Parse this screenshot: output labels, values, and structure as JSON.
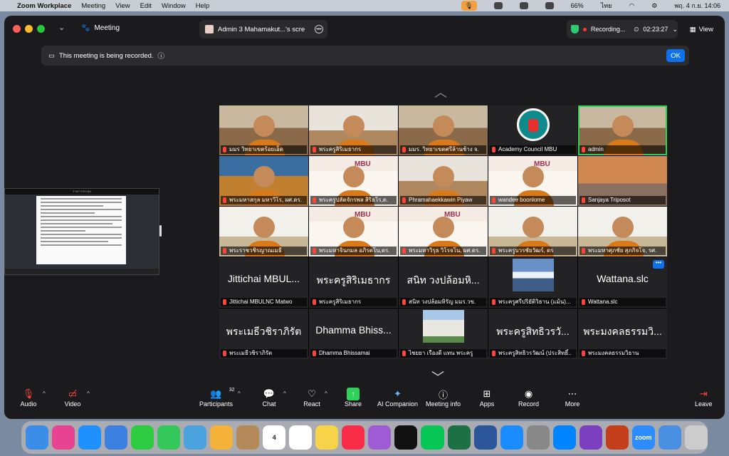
{
  "menubar": {
    "app": "Zoom Workplace",
    "items": [
      "Meeting",
      "View",
      "Edit",
      "Window",
      "Help"
    ],
    "battery": "66%",
    "lang": "ไทย",
    "datetime": "พฤ. 4 ก.ย.  14:06"
  },
  "titlebar": {
    "meeting_label": "Meeting",
    "tab_title": "Admin 3 Mahamakut...'s scre",
    "recording": "Recording...",
    "timer": "02:23:27",
    "view": "View"
  },
  "notice": {
    "text": "This meeting is being recorded.",
    "ok": "OK"
  },
  "tiles": [
    {
      "name": "มมร วิทยาเขตร้อยเอ็ด",
      "bg": "room"
    },
    {
      "name": "พระครูสิริเมธากร",
      "bg": "room2"
    },
    {
      "name": "มมร. วิทยาเขตศรีล้านช้าง จ.",
      "bg": "room"
    },
    {
      "name": "Academy Council MBU",
      "bg": "logo"
    },
    {
      "name": "admin",
      "bg": "room",
      "active": true
    },
    {
      "name": "พระมหาสกุล มหาวีโร, ผศ.ดร.",
      "bg": "temple"
    },
    {
      "name": "พระครูปลัดจักรพล สิริธโร,ด.",
      "bg": "slide"
    },
    {
      "name": "Phramahaekkawin Piyaw",
      "bg": "room2"
    },
    {
      "name": "wandee boonlome",
      "bg": "slide"
    },
    {
      "name": "Sanjaya Triposot",
      "bg": "bridge"
    },
    {
      "name": "พระราชวชิรญาณเมธี",
      "bg": "office"
    },
    {
      "name": "พระมหาจินกมล อภิรตโน,ดร.",
      "bg": "slide"
    },
    {
      "name": "พระมหาวิรุธ วิโรจโน, ผศ.ดร.",
      "bg": "slide"
    },
    {
      "name": "พระครูบวรชัยวัฒร์, ดร",
      "bg": "office"
    },
    {
      "name": "พระมหาศุภชัย สุภกิจโจ, รศ.",
      "bg": "office"
    },
    {
      "name": "Jittichai MBULNC Matwo",
      "big": "Jittichai MBUL..."
    },
    {
      "name": "พระครูสิริเมธากร",
      "big": "พระครูสิริเมธากร"
    },
    {
      "name": "สนิท วงปล้อมหิรัญ มมร.วข.",
      "big": "สนิท วงปล้อมหิ..."
    },
    {
      "name": "พระครูศรีปริยัติวิธาน (แม้น)...",
      "bg": "mtn"
    },
    {
      "name": "Wattana.slc",
      "big": "Wattana.slc",
      "more": true
    },
    {
      "name": "พระเมธีวชิราภิรัต",
      "big": "พระเมธีวชิราภิรัต"
    },
    {
      "name": "Dhamma Bhissamai",
      "big": "Dhamma Bhiss..."
    },
    {
      "name": "ไชยยา เรืองดี แทน พระครู",
      "bg": "bldg"
    },
    {
      "name": "พระครูสิทธิวรวัฒน์ (ประสิทธิ์..",
      "big": "พระครูสิทธิวรวั..."
    },
    {
      "name": "พระมงคลธรรมวิธาน",
      "big": "พระมงคลธรรมวิ..."
    }
  ],
  "share": {
    "title": "รายการประชุม"
  },
  "toolbar": {
    "audio": "Audio",
    "video": "Video",
    "participants": "Participants",
    "participants_count": "32",
    "chat": "Chat",
    "react": "React",
    "share": "Share",
    "ai": "AI Companion",
    "info": "Meeting info",
    "apps": "Apps",
    "record": "Record",
    "more": "More",
    "leave": "Leave"
  },
  "dock": [
    "Finder",
    "Launchpad",
    "Safari",
    "Mail",
    "FaceTime",
    "Messages",
    "Maps",
    "Photos",
    "Contacts",
    "Calendar",
    "Reminders",
    "Notes",
    "Music",
    "Podcasts",
    "TV",
    "LINE",
    "Excel",
    "Word",
    "App Store",
    "Settings",
    "Messenger",
    "Feedback",
    "PowerPoint",
    "zoom",
    "Folder",
    "Trash"
  ],
  "dock_calendar_day": "4",
  "dock_zoom_label": "zoom"
}
